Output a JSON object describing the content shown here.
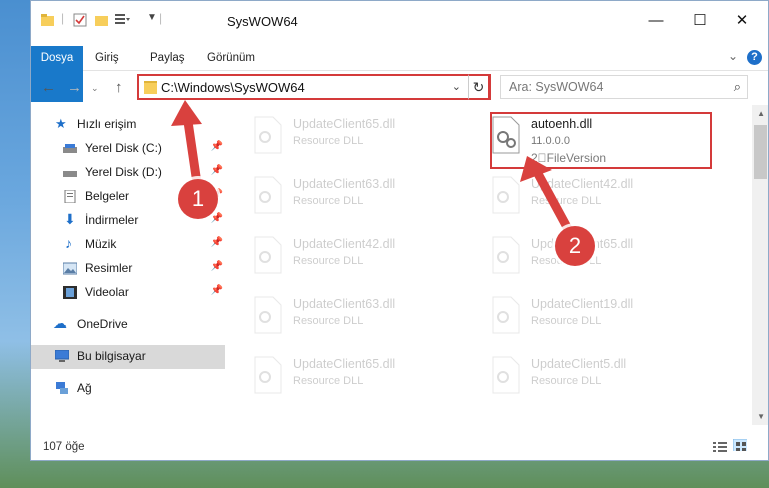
{
  "window": {
    "title": "SysWOW64",
    "minimize": "—",
    "maximize": "☐",
    "close": "✕"
  },
  "ribbon": {
    "tabs": [
      "Dosya",
      "Giriş",
      "Paylaş",
      "Görünüm"
    ],
    "help": "?"
  },
  "address": {
    "path": "C:\\Windows\\SysWOW64",
    "search_placeholder": "Ara: SysWOW64"
  },
  "sidebar": {
    "items": [
      {
        "label": "Hızlı erişim"
      },
      {
        "label": "Yerel Disk (C:)"
      },
      {
        "label": "Yerel Disk (D:)"
      },
      {
        "label": "Belgeler"
      },
      {
        "label": "İndirmeler"
      },
      {
        "label": "Müzik"
      },
      {
        "label": "Resimler"
      },
      {
        "label": "Videolar"
      },
      {
        "label": "OneDrive"
      },
      {
        "label": "Bu bilgisayar"
      },
      {
        "label": "Ağ"
      }
    ]
  },
  "files": {
    "highlighted": {
      "name": "autoenh.dll",
      "version": "11.0.0.0",
      "type": "2\u0000FileVersion"
    },
    "faded": [
      {
        "name": "UpdateClient65.dll",
        "type": "Resource DLL"
      },
      {
        "name": "UpdateClient63.dll",
        "type": "Resource DLL"
      },
      {
        "name": "UpdateClient42.dll",
        "type": "Resource DLL"
      },
      {
        "name": "UpdateClient42.dll",
        "type": "Resource DLL"
      },
      {
        "name": "UpdateClient65.dll",
        "type": "Resource DLL"
      },
      {
        "name": "UpdateClient63.dll",
        "type": "Resource DLL"
      },
      {
        "name": "UpdateClient19.dll",
        "type": "Resource DLL"
      },
      {
        "name": "UpdateClient65.dll",
        "type": "Resource DLL"
      },
      {
        "name": "UpdateClient5.dll",
        "type": "Resource DLL"
      }
    ]
  },
  "status": {
    "count": "107 öğe"
  },
  "callouts": {
    "one": "1",
    "two": "2"
  },
  "colors": {
    "accent": "#1979ca",
    "highlight": "#d43a3a",
    "selected": "#d9d9d9"
  }
}
